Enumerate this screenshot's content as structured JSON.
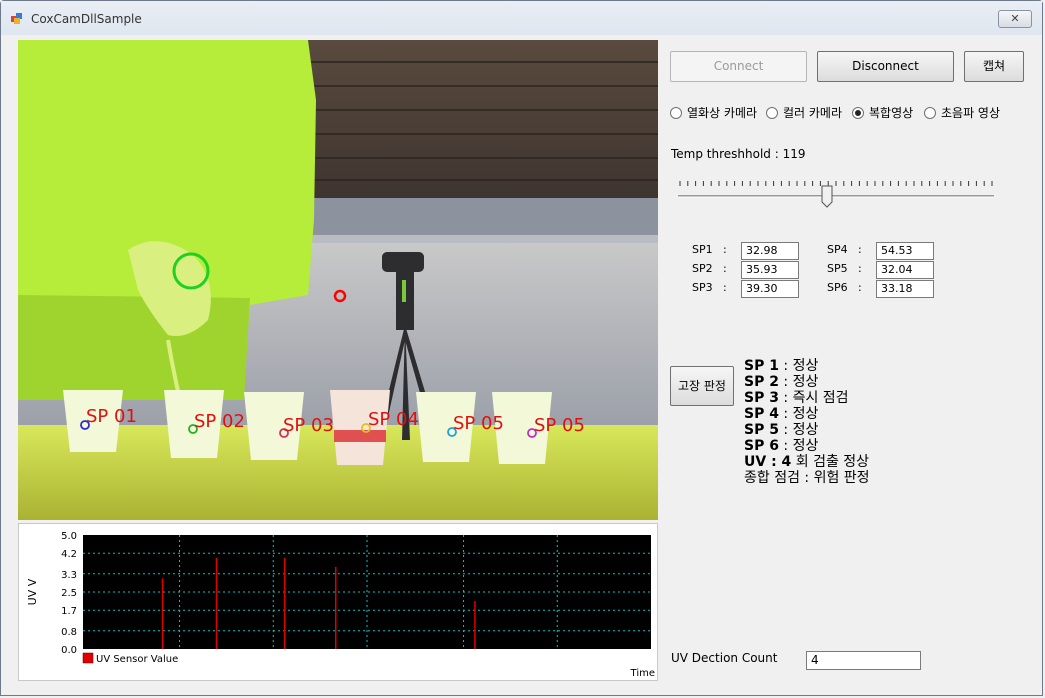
{
  "window": {
    "title": "CoxCamDllSample",
    "close_glyph": "✕"
  },
  "buttons": {
    "connect": "Connect",
    "disconnect": "Disconnect",
    "capture": "캡쳐",
    "fault_judge": "고장 판정"
  },
  "camera_modes": [
    {
      "label": "열화상 카메라",
      "selected": false
    },
    {
      "label": "컬러 카메라",
      "selected": false
    },
    {
      "label": "복합영상",
      "selected": true
    },
    {
      "label": "초음파 영상",
      "selected": false
    }
  ],
  "threshold": {
    "label": "Temp  threshhold  : 119",
    "value": 119
  },
  "sensors": [
    {
      "label": "SP1",
      "sep": ":",
      "value": "32.98"
    },
    {
      "label": "SP2",
      "sep": ":",
      "value": "35.93"
    },
    {
      "label": "SP3",
      "sep": ":",
      "value": "39.30"
    },
    {
      "label": "SP4",
      "sep": ":",
      "value": "54.53"
    },
    {
      "label": "SP5",
      "sep": ":",
      "value": "32.04"
    },
    {
      "label": "SP6",
      "sep": ":",
      "value": "33.18"
    }
  ],
  "results": [
    {
      "key": "SP 1",
      "text": " : 정상"
    },
    {
      "key": "SP 2",
      "text": " : 정상"
    },
    {
      "key": "SP 3",
      "text": " : 즉시 점검"
    },
    {
      "key": "SP 4",
      "text": " : 정상"
    },
    {
      "key": "SP 5",
      "text": " : 정상"
    },
    {
      "key": "SP 6",
      "text": " : 정상"
    },
    {
      "key": "UV : 4",
      "text": " 회 검출 정상"
    },
    {
      "key": "",
      "text": "종합 점검 : 위험 판정"
    }
  ],
  "uv_count": {
    "label": "UV Dection Count",
    "value": "4"
  },
  "video_labels": [
    "SP 01",
    "SP 02",
    "SP 03",
    "SP 04",
    "SP 05",
    "SP 05"
  ],
  "chart_data": {
    "type": "bar",
    "ylabel": "UV V",
    "xlabel": "Time",
    "yticks": [
      "5.0",
      "4.2",
      "3.3",
      "2.5",
      "1.7",
      "0.8",
      "0.0"
    ],
    "ylim": [
      0,
      5
    ],
    "legend": "UV Sensor Value",
    "legend_position": "bottom-left",
    "grid": true,
    "series": [
      {
        "name": "UV Sensor Value",
        "color": "#e00000",
        "points": [
          {
            "t": 0.14,
            "v": 3.1
          },
          {
            "t": 0.235,
            "v": 4.0
          },
          {
            "t": 0.355,
            "v": 4.0
          },
          {
            "t": 0.445,
            "v": 3.6
          },
          {
            "t": 0.69,
            "v": 2.1
          }
        ]
      }
    ]
  },
  "colors": {
    "background": "#f0f0f0",
    "chart_bg": "#000000",
    "grid": "#00c8c8",
    "uv": "#e00000",
    "video_tint": "#b4ee3c",
    "marker_red": "#ff0000",
    "marker_green": "#1fd01f"
  }
}
